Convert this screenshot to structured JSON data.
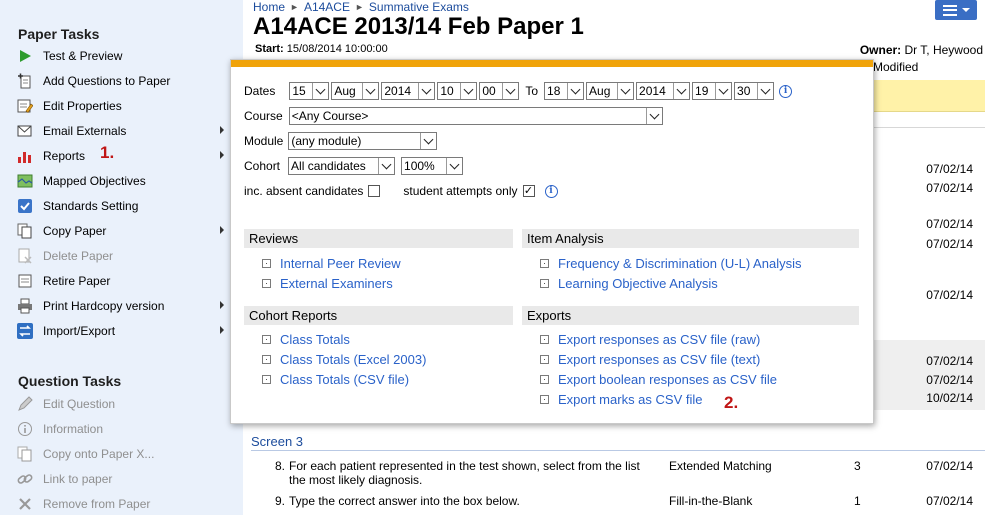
{
  "sidebar": {
    "paper_tasks_heading": "Paper Tasks",
    "paper_tasks": [
      {
        "label": "Test & Preview",
        "icon": "play-icon"
      },
      {
        "label": "Add Questions to Paper",
        "icon": "add-document-icon"
      },
      {
        "label": "Edit Properties",
        "icon": "edit-properties-icon"
      },
      {
        "label": "Email Externals",
        "icon": "envelope-icon"
      },
      {
        "label": "Reports",
        "icon": "bar-chart-icon"
      },
      {
        "label": "Mapped Objectives",
        "icon": "mapped-objectives-icon"
      },
      {
        "label": "Standards Setting",
        "icon": "checkbox-icon"
      },
      {
        "label": "Copy Paper",
        "icon": "copy-icon"
      },
      {
        "label": "Delete Paper",
        "icon": "delete-document-icon"
      },
      {
        "label": "Retire Paper",
        "icon": "retire-icon"
      },
      {
        "label": "Print Hardcopy version",
        "icon": "printer-icon"
      },
      {
        "label": "Import/Export",
        "icon": "import-export-icon"
      }
    ],
    "question_tasks_heading": "Question Tasks",
    "question_tasks": [
      {
        "label": "Edit Question",
        "icon": "pencil-icon"
      },
      {
        "label": "Information",
        "icon": "info-icon"
      },
      {
        "label": "Copy onto Paper X...",
        "icon": "copy-icon"
      },
      {
        "label": "Link to paper",
        "icon": "link-icon"
      },
      {
        "label": "Remove from Paper",
        "icon": "remove-icon"
      }
    ]
  },
  "callouts": {
    "one": "1.",
    "two": "2."
  },
  "header": {
    "breadcrumb": [
      "Home",
      "A14ACE",
      "Summative Exams"
    ],
    "title": "A14ACE 2013/14 Feb Paper 1",
    "start_label": "Start:",
    "start_value": "15/08/2014 10:00:00",
    "owner_label": "Owner:",
    "owner_value": "Dr T, Heywood",
    "modified_label": "Modified"
  },
  "background_dates": [
    "07/02/14",
    "07/02/14",
    "07/02/14",
    "07/02/14",
    "07/02/14",
    "07/02/14",
    "07/02/14",
    "10/02/14"
  ],
  "screen3": {
    "label": "Screen 3",
    "rows": [
      {
        "num": "8.",
        "text": "For each patient represented in the test shown, select from the list the most likely diagnosis.",
        "type": "Extended Matching",
        "marks": "3",
        "date": "07/02/14"
      },
      {
        "num": "9.",
        "text": "Type the correct answer into the box below.",
        "type": "Fill-in-the-Blank",
        "marks": "1",
        "date": "07/02/14"
      }
    ]
  },
  "popup": {
    "dates_label": "Dates",
    "from": {
      "day": "15",
      "month": "Aug",
      "year": "2014",
      "hour": "10",
      "minute": "00"
    },
    "to_label": "To",
    "to": {
      "day": "18",
      "month": "Aug",
      "year": "2014",
      "hour": "19",
      "minute": "30"
    },
    "course_label": "Course",
    "course_value": "<Any Course>",
    "module_label": "Module",
    "module_value": "(any module)",
    "cohort_label": "Cohort",
    "cohort_value": "All candidates",
    "percent_value": "100%",
    "absent_label": "inc. absent candidates",
    "absent_checked": false,
    "attempts_label": "student attempts only",
    "attempts_checked": true,
    "sections": {
      "reviews": {
        "heading": "Reviews",
        "links": [
          "Internal Peer Review",
          "External Examiners"
        ]
      },
      "item_analysis": {
        "heading": "Item Analysis",
        "links": [
          "Frequency & Discrimination (U-L) Analysis",
          "Learning Objective Analysis"
        ]
      },
      "cohort_reports": {
        "heading": "Cohort Reports",
        "links": [
          "Class Totals",
          "Class Totals (Excel 2003)",
          "Class Totals (CSV file)"
        ]
      },
      "exports": {
        "heading": "Exports",
        "links": [
          "Export responses as CSV file (raw)",
          "Export responses as CSV file (text)",
          "Export boolean responses as CSV file",
          "Export marks as CSV file"
        ]
      }
    }
  },
  "colors": {
    "accent_bar": "#f0a30a",
    "link": "#2a62c9",
    "sidebar_bg": "#eaf1fb",
    "callout": "#c01616"
  }
}
